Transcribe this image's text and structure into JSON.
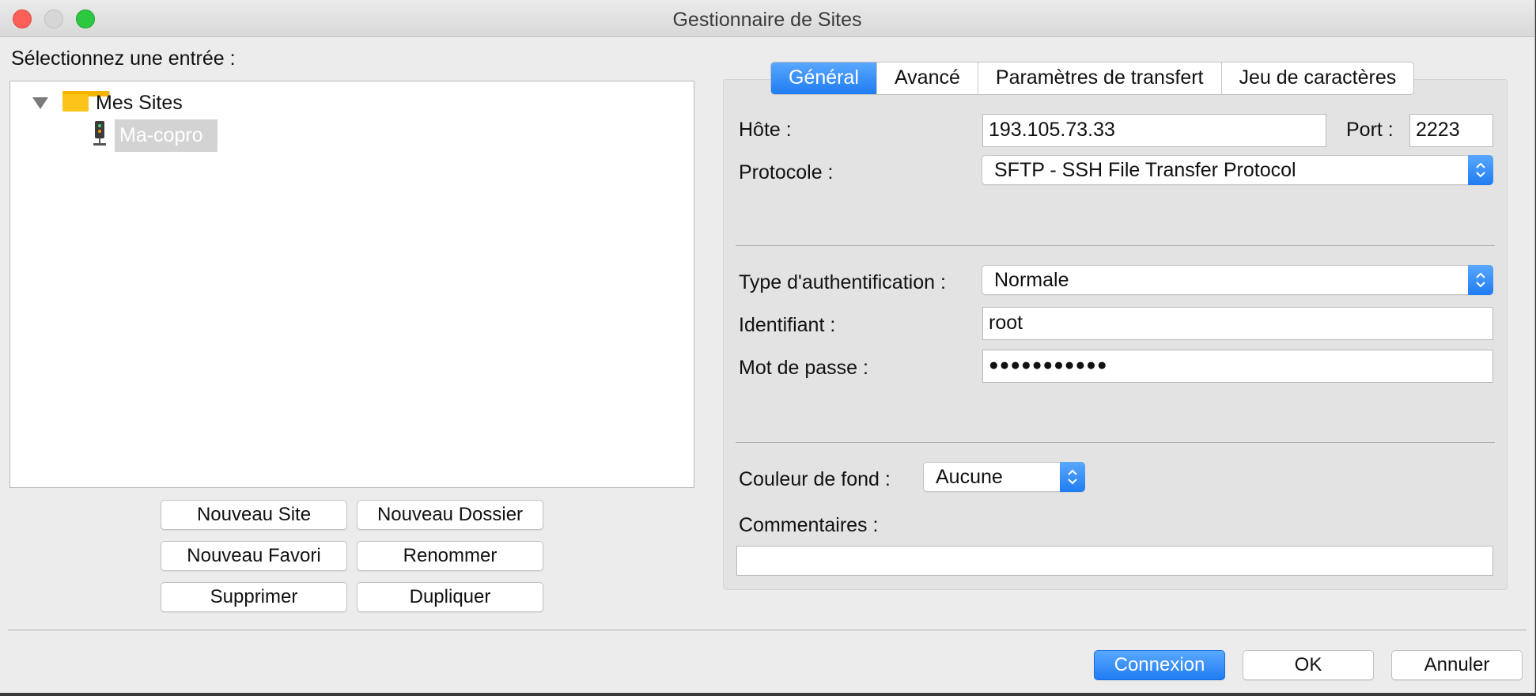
{
  "window": {
    "title": "Gestionnaire de Sites"
  },
  "left": {
    "prompt": "Sélectionnez une entrée :",
    "tree": {
      "folder_label": "Mes Sites",
      "site_label": "Ma-copro"
    },
    "buttons": {
      "new_site": "Nouveau Site",
      "new_folder": "Nouveau Dossier",
      "new_bookmark": "Nouveau Favori",
      "rename": "Renommer",
      "delete": "Supprimer",
      "duplicate": "Dupliquer"
    }
  },
  "tabs": [
    "Général",
    "Avancé",
    "Paramètres de transfert",
    "Jeu de caractères"
  ],
  "active_tab": "Général",
  "general": {
    "host_label": "Hôte :",
    "host_value": "193.105.73.33",
    "port_label": "Port :",
    "port_value": "2223",
    "protocol_label": "Protocole :",
    "protocol_value": "SFTP - SSH File Transfer Protocol",
    "auth_label": "Type d'authentification :",
    "auth_value": "Normale",
    "user_label": "Identifiant :",
    "user_value": "root",
    "password_label": "Mot de passe :",
    "password_value": "●●●●●●●●●●●",
    "bgcolor_label": "Couleur de fond :",
    "bgcolor_value": "Aucune",
    "comments_label": "Commentaires :",
    "comments_value": ""
  },
  "footer": {
    "connect": "Connexion",
    "ok": "OK",
    "cancel": "Annuler"
  },
  "colors": {
    "accent": "#1f7cf2",
    "window_bg": "#ececec",
    "selection_bg": "#d3d3d3"
  }
}
